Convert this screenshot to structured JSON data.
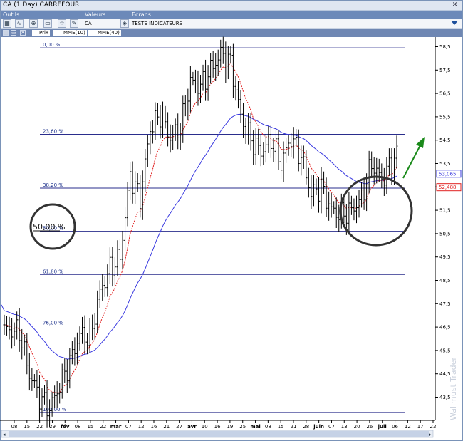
{
  "window": {
    "title": "CA (1 Day) CARREFOUR"
  },
  "menu": {
    "outils": "Outils",
    "valeurs": "Valeurs",
    "ecrans": "Ecrans"
  },
  "toolbar": {
    "symbol": "CA",
    "screen_name": "TESTE INDICATEURS"
  },
  "legend": {
    "prix": "Prix",
    "mme10": "MME(10)",
    "mme40": "MME(40)"
  },
  "watermark": "Wallmust Trader",
  "colors": {
    "fib_line": "#2a2d8c",
    "mme10": "#e02020",
    "mme40": "#3a3ae0",
    "price": "#000000",
    "arrow": "#1a8a1a",
    "axis_bg": "#ffffff"
  },
  "chart_data": {
    "type": "ohlc",
    "ylim": [
      42.5,
      59.0
    ],
    "y_ticks": [
      "58,5",
      "57,5",
      "56,5",
      "55,5",
      "54,5",
      "53,5",
      "52,5",
      "51,5",
      "50,5",
      "49,5",
      "48,5",
      "47,5",
      "46,5",
      "45,5",
      "44,5",
      "43,5"
    ],
    "y_tick_values": [
      58.5,
      57.5,
      56.5,
      55.5,
      54.5,
      53.5,
      52.5,
      51.5,
      50.5,
      49.5,
      48.5,
      47.5,
      46.5,
      45.5,
      44.5,
      43.5
    ],
    "x_ticks": [
      "08",
      "15",
      "22",
      "29",
      "fév",
      "08",
      "15",
      "22",
      "mar",
      "07",
      "12",
      "16",
      "21",
      "27",
      "avr",
      "10",
      "16",
      "19",
      "25",
      "mai",
      "08",
      "15",
      "21",
      "28",
      "juin",
      "07",
      "13",
      "20",
      "26",
      "juil",
      "06",
      "12",
      "17",
      "23"
    ],
    "fibonacci": [
      {
        "label": "0,00 %",
        "level": 58.45
      },
      {
        "label": "23,60 %",
        "level": 54.75
      },
      {
        "label": "38,20 %",
        "level": 52.45
      },
      {
        "label": "50,00 %",
        "level": 50.6
      },
      {
        "label": "61,80 %",
        "level": 48.75
      },
      {
        "label": "76,00 %",
        "level": 46.55
      },
      {
        "label": "100,00 %",
        "level": 42.85
      }
    ],
    "last_values": [
      {
        "name": "MME(40)",
        "label": "53,065",
        "value": 53.065
      },
      {
        "name": "MME(10)",
        "label": "52,488",
        "value": 52.488
      }
    ],
    "bar_count": 157,
    "key_closes": [
      [
        0,
        46.4
      ],
      [
        6,
        46.3
      ],
      [
        10,
        44.5
      ],
      [
        14,
        43.5
      ],
      [
        18,
        43.0
      ],
      [
        22,
        44.0
      ],
      [
        26,
        45.0
      ],
      [
        30,
        46.2
      ],
      [
        34,
        46.0
      ],
      [
        38,
        48.0
      ],
      [
        42,
        49.0
      ],
      [
        46,
        49.5
      ],
      [
        50,
        53.0
      ],
      [
        54,
        52.0
      ],
      [
        58,
        55.0
      ],
      [
        62,
        55.6
      ],
      [
        66,
        54.6
      ],
      [
        70,
        55.0
      ],
      [
        74,
        57.0
      ],
      [
        78,
        56.8
      ],
      [
        82,
        57.5
      ],
      [
        86,
        58.2
      ],
      [
        90,
        57.8
      ],
      [
        94,
        55.5
      ],
      [
        98,
        54.5
      ],
      [
        102,
        54.0
      ],
      [
        106,
        54.5
      ],
      [
        110,
        53.5
      ],
      [
        114,
        54.6
      ],
      [
        118,
        53.8
      ],
      [
        122,
        52.2
      ],
      [
        126,
        52.5
      ],
      [
        130,
        51.5
      ],
      [
        134,
        51.3
      ],
      [
        138,
        51.5
      ],
      [
        142,
        52.0
      ],
      [
        146,
        53.5
      ],
      [
        150,
        52.8
      ],
      [
        156,
        53.9
      ]
    ]
  }
}
